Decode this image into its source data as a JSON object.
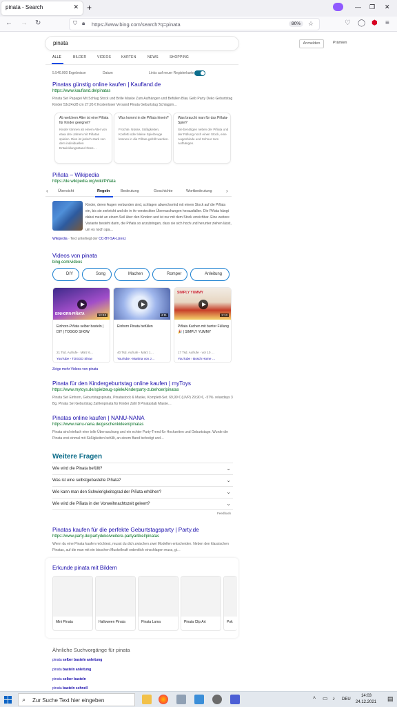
{
  "browser": {
    "tab_title": "pinata - Search",
    "url": "https://www.bing.com/search?q=pinata",
    "zoom": "80%"
  },
  "search": {
    "query": "pinata",
    "signin_label": "Anmelden",
    "rewards_label": "Prämien"
  },
  "scopes": [
    "ALLE",
    "BILDER",
    "VIDEOS",
    "KARTEN",
    "NEWS",
    "SHOPPING"
  ],
  "toolbar": {
    "results_count": "5.540.000 Ergebnisse",
    "date_filter": "Datum",
    "newtab_label": "Links auf neuer Registerkarte öffnen"
  },
  "result1": {
    "title": "Pinatas günstig online kaufen | Kaufland.de",
    "url": "https://www.kaufland.de/pinatas",
    "snippet": "Pinata Set Papagei Mit Schlag Stock und Brille Maske Zum Aufhängen und Befüllen Blau Gelb Party Deko Geburtstag Kinder 53x24x28 cm 27,95 € Kostenloser Versand Pinata Geburtstag Schlagpin…",
    "cards": [
      {
        "q": "Ab welchem Alter ist eine Piñata für Kinder geeignet?",
        "a": "Kinder können ab einem Alter von etwa drei Jahren mit Piñatas spielen. Dies ist jedoch stark von dem individuellen Entwicklungsstand Ihres…"
      },
      {
        "q": "Was kommt in die Piñata hinein?",
        "a": "Früchte, Nüsse, Süßigkeiten, Konfetti oder kleine Spielzeuge können in die Piñata gefüllt werden."
      },
      {
        "q": "Was braucht man für das Piñata-Spiel?",
        "a": "Sie benötigen neben der Piñata und der Füllung noch einen Stock, eine Augenbinde und Schnur zum Aufhängen."
      }
    ]
  },
  "wiki": {
    "title": "Piñata – Wikipedia",
    "url": "https://de.wikipedia.org/wiki/Piñata",
    "tabs": [
      "Übersicht",
      "Regeln",
      "Bedeutung",
      "Geschichte",
      "Wortbedeutung"
    ],
    "snippet": "Kinder, deren Augen verbunden sind, schlagen abwechselnd mit einem Stock auf die Piñata ein, bis sie zerbricht und die in ihr versteckten Überraschungen herausfallen. Die Piñata hängt dabei meist an einem Seil über den Kindern und ist nur mit dem Stock erreichbar. Eine weitere Variante besteht darin, die Piñata so anzubringen, dass sie sich hoch und herunter ziehen lässt, um es noch spa…",
    "source": "Wikipedia",
    "license_text": "· Text unterliegt der",
    "license_link": "CC-BY-SA-Lizenz"
  },
  "videos": {
    "title": "Videos von pinata",
    "url": "bing.com/videos",
    "chips": [
      "DIY",
      "Song",
      "Machen",
      "Romper",
      "Anleitung"
    ],
    "items": [
      {
        "title": "Einhorn-Piñata selber basteln | DIY | TOGGO SHOW",
        "duration": "12:43",
        "meta": "21 Tsd. Aufrufe · März 6…",
        "source": "YouTube › TOGGO Show",
        "overlay": "EINHORN-PIÑATA"
      },
      {
        "title": "Einhorn Pinata befüllen",
        "duration": "4:11",
        "meta": "40 Tsd. Aufrufe · März 1…",
        "source": "YouTube › Martina von J…",
        "overlay": ""
      },
      {
        "title": "Piñata Kuchen mit bunter Füllung 🎉 | SIMPLY YUMMY",
        "duration": "2:13",
        "meta": "17 Tsd. Aufrufe · vor 10 …",
        "source": "YouTube › Bosch Home …",
        "overlay": "SIMPLY YUMMY"
      }
    ],
    "more_label": "Zeige mehr Videos von pinata"
  },
  "result3": {
    "title": "Pinata für den Kindergeburtstag online kaufen | myToys",
    "url": "https://www.mytoys.de/spielzeug-spiele/kinderparty-zubehoer/pinatas",
    "snippet": "Pinata Set Einhorn, Geburtstagspinata, Pinatastock & Maske, Komplett-Set. 69,99 € (UVP) 29,90 €, -57%. relaxdays 3 Bg. Pinata Set Geburtstag Zahlenpinata für Kinder Zahl 8 Pinatastab Maske…"
  },
  "result4": {
    "title": "Pinatas online kaufen | NANU-NANA",
    "url": "https://www.nanu-nana.de/geschenkideen/pinatas",
    "snippet": "Pinata sind einfach eine tolle Überraschung und ein echter Party-Trend für Hochzeiten und Geburtstage. Wurde die Pinata erst einmal mit Süßigkeiten befüllt, an einem Band befestigt und…"
  },
  "faq": {
    "title": "Weitere Fragen",
    "questions": [
      "Wie wird die Pinata befüllt?",
      "Was ist eine selbstgebastelte Piñata?",
      "Wie kann man den Schwierigkeitsgrad der Piñata erhöhen?",
      "Wie wird die Piñata in der Vorweihnachtszeit geleert?"
    ],
    "feedback": "Feedback"
  },
  "result5": {
    "title": "Pinatas kaufen für die perfekte Geburtstagsparty | Party.de",
    "url": "https://www.party.de/partydeko/weitere-partyartikel/pinatas",
    "snippet": "Wenn du eine Pinata kaufen möchtest, musst du dich zwischen zwei Modellen entscheiden. Neben den klassischen Pinatas, auf die man mit ein bisschen Muskelkraft ordentlich einschlagen muss, gi…"
  },
  "images": {
    "title": "Erkunde pinata mit Bildern",
    "labels": [
      "Mini Pinata",
      "Halloween Pinata",
      "Pinata Lama",
      "Pinata Clip Art",
      "Pok"
    ]
  },
  "similar": {
    "title": "Ähnliche Suchvorgänge für pinata",
    "items": [
      {
        "base": "pinata",
        "bold": "selber basteln anleitung"
      },
      {
        "base": "pinata",
        "bold": "basteln anleitung"
      },
      {
        "base": "pinata",
        "bold": "selber basteln"
      },
      {
        "base": "pinata",
        "bold": "basteln schnell"
      }
    ]
  },
  "taskbar": {
    "search_placeholder": "Zur Suche Text hier eingeben",
    "lang": "DEU",
    "time": "14:03",
    "date": "24.12.2021"
  },
  "colors": {
    "link": "#1a0dab",
    "url": "#006d21",
    "accent": "#174ae4",
    "faq_title": "#0e6d8a"
  }
}
